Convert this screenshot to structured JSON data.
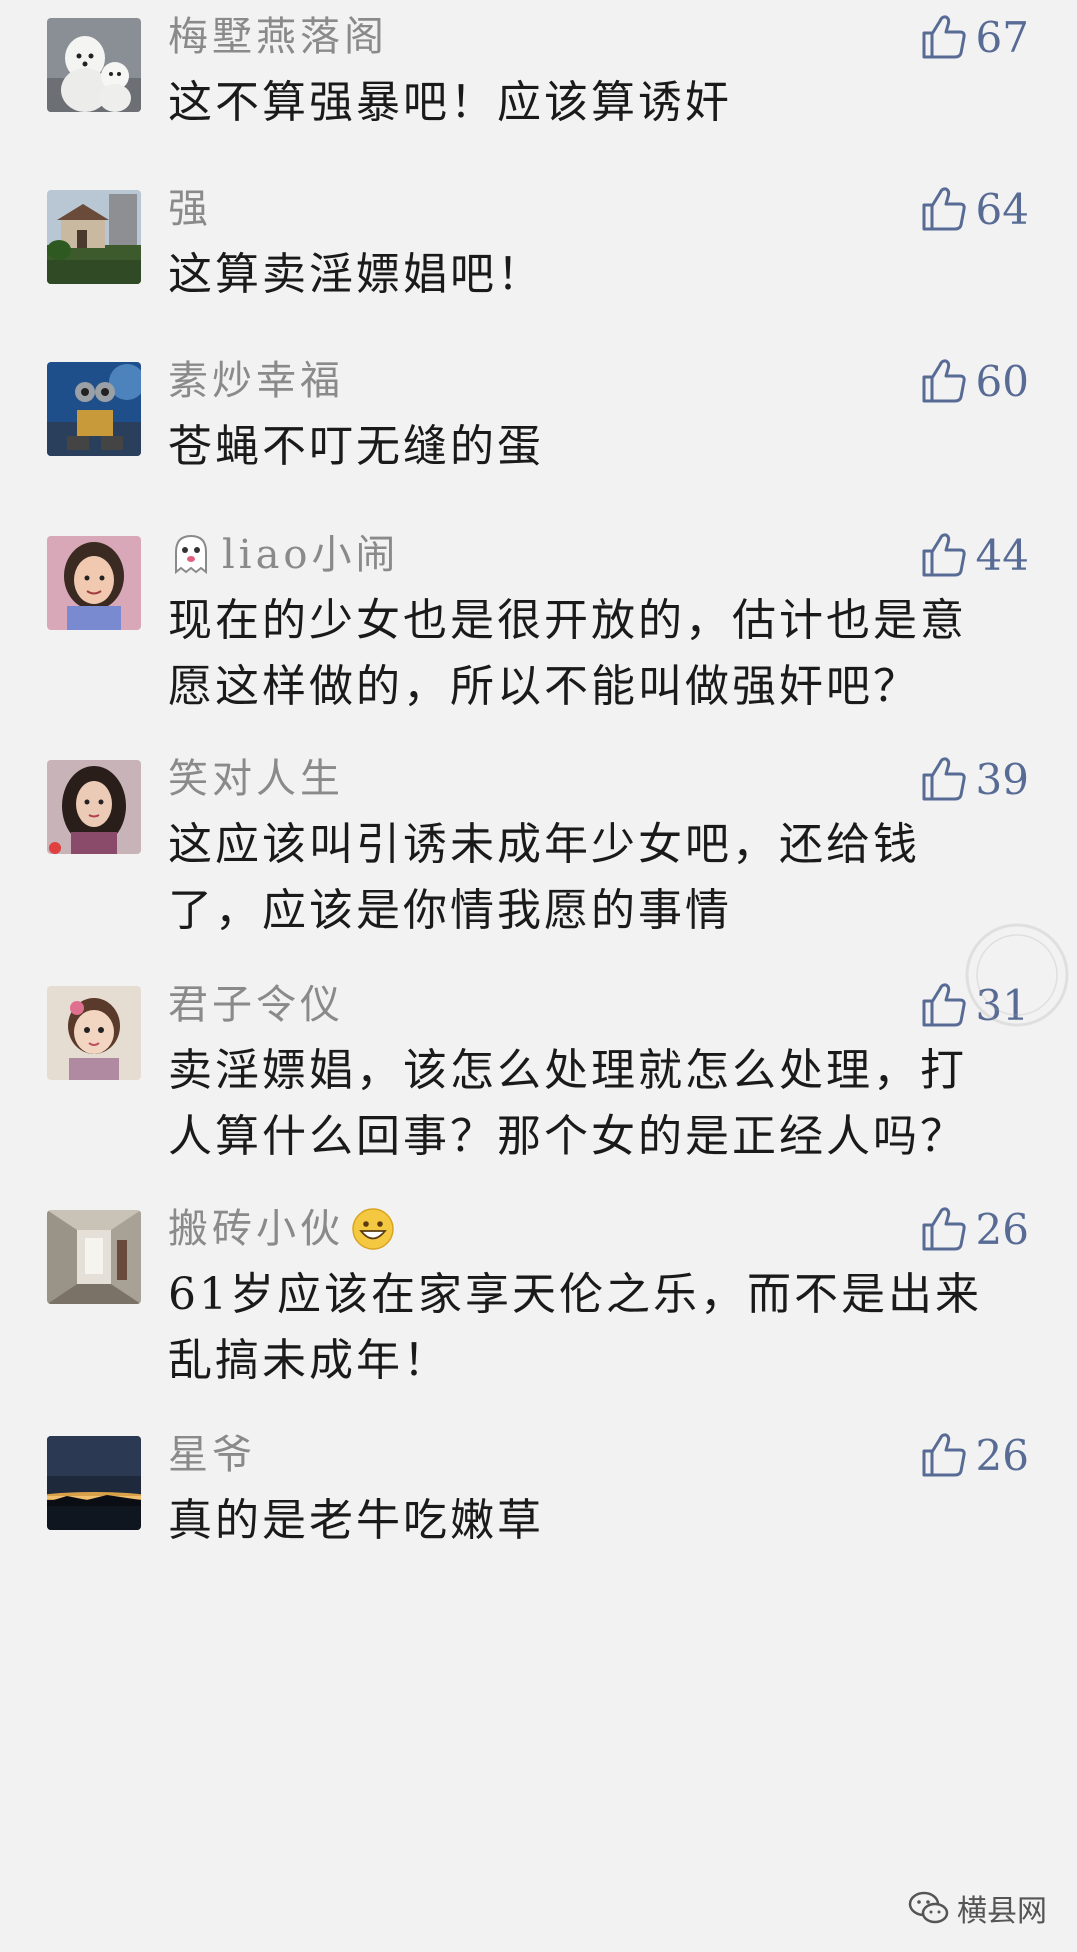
{
  "comments": [
    {
      "nickname": "梅墅燕落阁",
      "likes": "67",
      "avatar": "white-dogs-avatar",
      "lines": [
        "这不算强暴吧！应该算诱奸"
      ]
    },
    {
      "nickname": "强",
      "likes": "64",
      "avatar": "mansion-avatar",
      "lines": [
        "这算卖淫嫖娼吧！"
      ]
    },
    {
      "nickname": "素炒幸福",
      "likes": "60",
      "avatar": "robot-avatar",
      "lines": [
        "苍蝇不叮无缝的蛋"
      ]
    },
    {
      "nickname": "liao小闹",
      "likes": "44",
      "avatar": "woman-avatar",
      "lead_emoji": "ghost-emoji",
      "lines": [
        "现在的少女也是很开放的，估计也是意",
        "愿这样做的，所以不能叫做强奸吧？"
      ]
    },
    {
      "nickname": "笑对人生",
      "likes": "39",
      "avatar": "girl-portrait-avatar",
      "lines": [
        "这应该叫引诱未成年少女吧，还给钱",
        "了，应该是你情我愿的事情"
      ]
    },
    {
      "nickname": "君子令仪",
      "likes": "31",
      "avatar": "child-avatar",
      "lines": [
        "卖淫嫖娼，该怎么处理就怎么处理，打",
        "人算什么回事？那个女的是正经人吗？"
      ]
    },
    {
      "nickname": "搬砖小伙",
      "likes": "26",
      "avatar": "hallway-avatar",
      "trail_emoji": "grin-emoji",
      "lines": [
        "61岁应该在家享天伦之乐，而不是出来",
        "乱搞未成年！"
      ]
    },
    {
      "nickname": "星爷",
      "likes": "26",
      "avatar": "sunset-avatar",
      "lines": [
        "真的是老牛吃嫩草"
      ]
    }
  ],
  "watermark": {
    "text": "横县网",
    "icon": "wechat-icon"
  },
  "colors": {
    "background": "#f2f2f2",
    "nickname": "#8a8a8a",
    "like": "#576b95",
    "text": "#1a1a1a"
  }
}
